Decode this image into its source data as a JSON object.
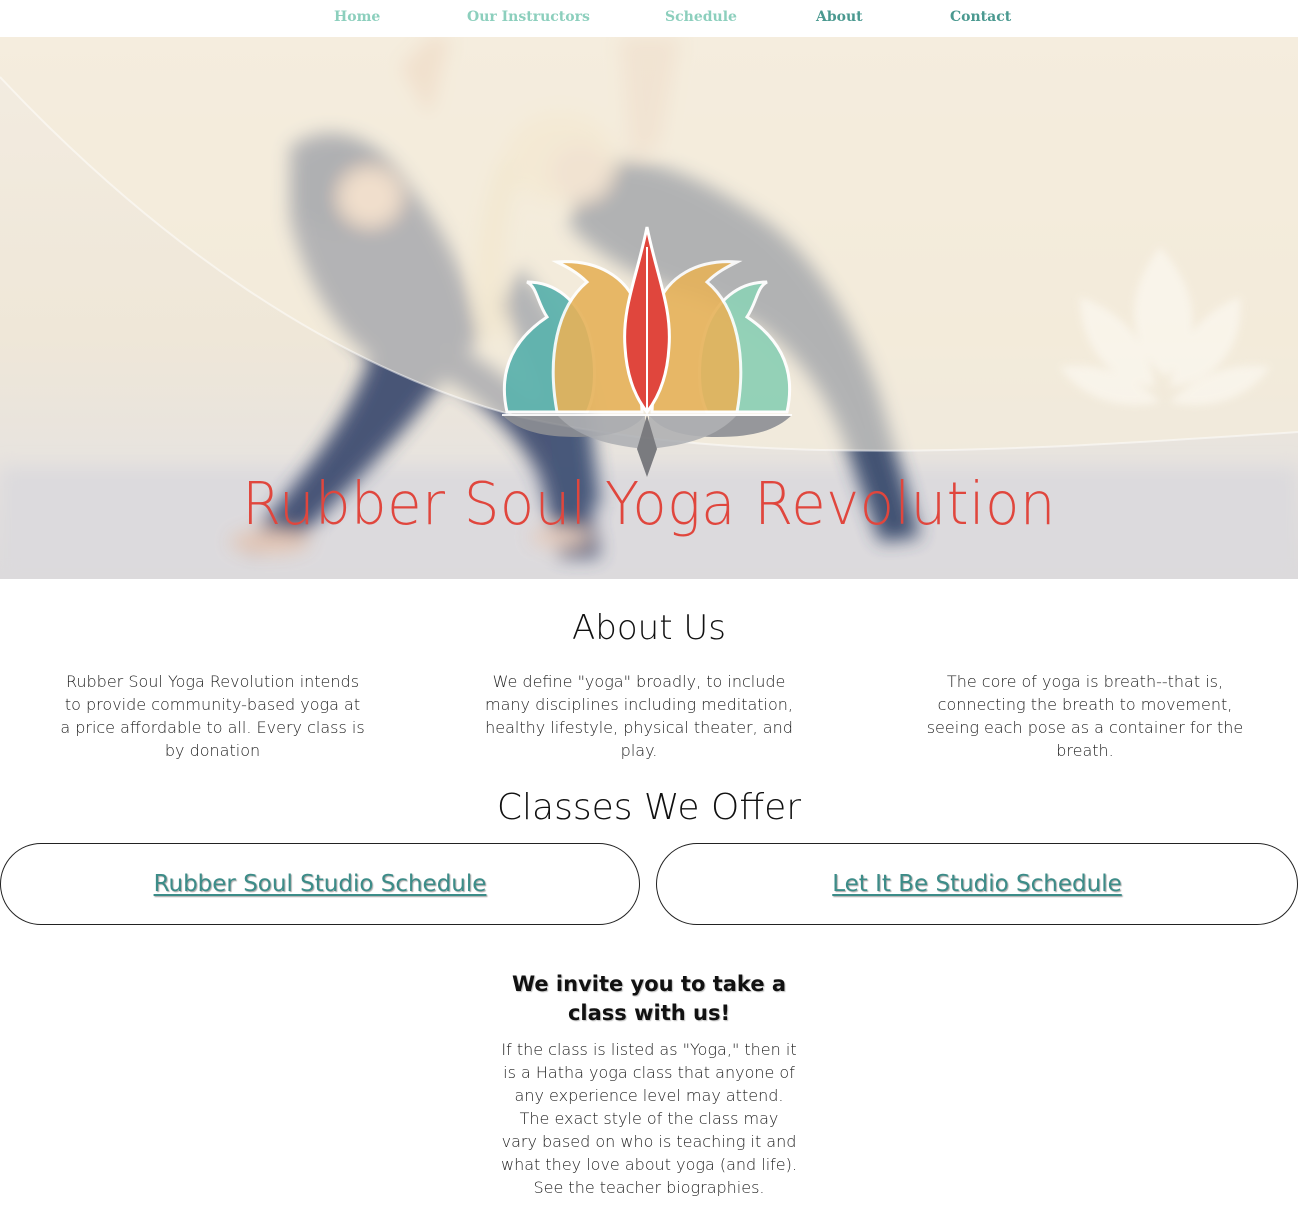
{
  "nav": {
    "items": [
      {
        "label": "Home"
      },
      {
        "label": "Our Instructors"
      },
      {
        "label": "Schedule"
      },
      {
        "label": "About"
      },
      {
        "label": "Contact"
      }
    ],
    "active": "About"
  },
  "hero": {
    "title": "Rubber Soul Yoga Revolution",
    "logo_icon": "lotus-logo-icon",
    "accent_color": "#e0463d"
  },
  "about": {
    "heading": "About Us",
    "columns": [
      "Rubber Soul Yoga Revolution intends to provide community-based yoga at a price affordable to all. Every class is by donation",
      "We define \"yoga\" broadly, to include many disciplines including meditation, healthy lifestyle, physical theater, and play.",
      "The core of yoga is breath--that is, connecting the breath to movement, seeing each pose as a container for the breath."
    ]
  },
  "classes": {
    "heading": "Classes We Offer",
    "links": [
      {
        "label": "Rubber Soul Studio Schedule"
      },
      {
        "label": "Let It Be Studio Schedule"
      }
    ],
    "link_color": "#3c8c88"
  },
  "invite": {
    "heading": "We invite you to take a class with us!",
    "body": "If the class is listed as \"Yoga,\" then it is a Hatha yoga class that anyone of any experience level may attend. The exact style of the class may vary based on who is teaching it and what they love about yoga (and life). See the teacher biographies."
  }
}
